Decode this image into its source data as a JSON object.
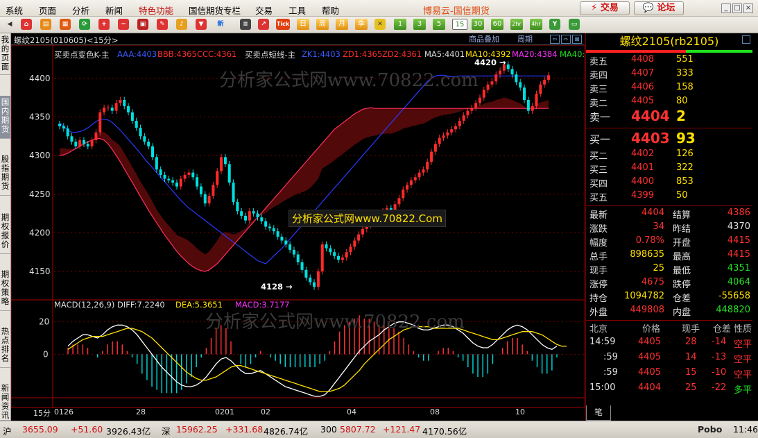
{
  "menu": {
    "items": [
      "系统",
      "页面",
      "分析",
      "新闻",
      "特色功能",
      "国信期货专栏",
      "交易",
      "工具",
      "帮助"
    ],
    "brand": "博易云-国信期货",
    "trade_btn": "交易",
    "forum_btn": "论坛"
  },
  "toolbar": {
    "labels": [
      "Tick",
      "日",
      "周",
      "月",
      "季",
      "1",
      "3",
      "5",
      "15",
      "30",
      "60",
      "2hr",
      "4hr"
    ]
  },
  "leftnav": [
    "我的页面",
    "国内期货",
    "股指期货",
    "期权报价",
    "期权策略",
    "热点排名",
    "新闻资讯"
  ],
  "chart_header": {
    "title": "螺纹2105(010605)<15分>",
    "overlay": "商品叠加",
    "period": "周期"
  },
  "main_legend": {
    "part1": "买卖点变色K-主",
    "aaa": "AAA:4403",
    "bbb": "BBB:4365",
    "ccc": "CCC:4361",
    "part2": "买卖点短线-主",
    "zk": "ZK1:4403",
    "zd1": "ZD1:4365",
    "zd2": "ZD2:4361",
    "ma5": "MA5:4401",
    "ma10": "MA10:4392",
    "ma20": "MA20:4384",
    "ma40": "MA40:4"
  },
  "macd_legend": {
    "name": "MACD(12,26,9)",
    "diff": "DIFF:7.2240",
    "dea": "DEA:5.3651",
    "macd": "MACD:3.7177"
  },
  "watermark": "分析家公式网www.70822.com",
  "watermark_box": "分析家公式网www.70822.Com",
  "annotations": {
    "high": "4420",
    "low": "4128"
  },
  "chart_data": {
    "type": "line",
    "ylim": [
      4115,
      4425
    ],
    "yticks": [
      4150,
      4200,
      4250,
      4300,
      4350,
      4400
    ],
    "macd_ylim": [
      -32,
      28
    ],
    "macd_yticks": [
      20,
      0
    ],
    "xlabels": [
      "0126",
      "28",
      "0201",
      "02",
      "04",
      "08",
      "10"
    ],
    "period_label": "15分",
    "close": [
      4338,
      4335,
      4325,
      4318,
      4312,
      4320,
      4315,
      4312,
      4320,
      4330,
      4356,
      4362,
      4362,
      4358,
      4368,
      4372,
      4364,
      4356,
      4345,
      4336,
      4325,
      4318,
      4312,
      4298,
      4282,
      4275,
      4270,
      4268,
      4265,
      4260,
      4270,
      4275,
      4278,
      4272,
      4260,
      4250,
      4238,
      4248,
      4262,
      4280,
      4298,
      4289,
      4265,
      4240,
      4228,
      4222,
      4216,
      4228,
      4225,
      4220,
      4215,
      4208,
      4206,
      4202,
      4195,
      4190,
      4185,
      4178,
      4172,
      4162,
      4152,
      4142,
      4136,
      4130,
      4150,
      4185,
      4180,
      4175,
      4170,
      4165,
      4168,
      4175,
      4182,
      4190,
      4198,
      4205,
      4210,
      4214,
      4220,
      4226,
      4228,
      4232,
      4230,
      4237,
      4245,
      4256,
      4262,
      4268,
      4272,
      4278,
      4282,
      4292,
      4305,
      4315,
      4323,
      4326,
      4330,
      4334,
      4338,
      4345,
      4352,
      4358,
      4362,
      4368,
      4375,
      4385,
      4392,
      4396,
      4405,
      4410,
      4418,
      4412,
      4405,
      4395,
      4388,
      4372,
      4358,
      4364,
      4380,
      4392,
      4398,
      4404
    ],
    "aaa": [
      4342,
      4338,
      4333,
      4330,
      4330,
      4331,
      4333,
      4336,
      4340,
      4344,
      4347,
      4347,
      4346,
      4343,
      4338,
      4333,
      4327,
      4321,
      4315,
      4309,
      4303,
      4296,
      4290,
      4284,
      4278,
      4272,
      4266,
      4260,
      4254,
      4248,
      4242,
      4237,
      4232,
      4228,
      4224,
      4220,
      4216,
      4212,
      4208,
      4204,
      4200,
      4196,
      4192,
      4188,
      4184,
      4180,
      4176,
      4172,
      4168,
      4164,
      4162,
      4160,
      4165,
      4170,
      4175,
      4180,
      4186,
      4192,
      4198,
      4204,
      4210,
      4216,
      4222,
      4228,
      4234,
      4240,
      4246,
      4252,
      4258,
      4264,
      4270,
      4276,
      4282,
      4288,
      4294,
      4300,
      4306,
      4312,
      4318,
      4324,
      4330,
      4336,
      4342,
      4348,
      4354,
      4360,
      4366,
      4372,
      4378,
      4384,
      4390,
      4396,
      4400,
      4403,
      4404,
      4404,
      4403,
      4402,
      4402,
      4403,
      4403,
      4403,
      4403,
      4403,
      4403,
      4403,
      4403,
      4403,
      4403,
      4403,
      4403,
      4403,
      4403,
      4403,
      4403,
      4403,
      4403,
      4403,
      4403,
      4403,
      4403,
      4403
    ],
    "ccc": [
      4300,
      4301,
      4303,
      4306,
      4309,
      4312,
      4315,
      4318,
      4320,
      4322,
      4322,
      4320,
      4315,
      4308,
      4300,
      4292,
      4283,
      4274,
      4265,
      4256,
      4247,
      4238,
      4229,
      4221,
      4213,
      4205,
      4197,
      4190,
      4183,
      4176,
      4170,
      4165,
      4160,
      4156,
      4153,
      4151,
      4150,
      4152,
      4156,
      4160,
      4166,
      4172,
      4178,
      4184,
      4190,
      4196,
      4202,
      4208,
      4214,
      4220,
      4226,
      4232,
      4238,
      4244,
      4250,
      4256,
      4262,
      4268,
      4274,
      4280,
      4286,
      4292,
      4298,
      4304,
      4310,
      4316,
      4322,
      4328,
      4334,
      4338,
      4342,
      4346,
      4350,
      4354,
      4357,
      4360,
      4361,
      4362,
      4361,
      4361,
      4361,
      4361,
      4361,
      4361,
      4361,
      4361,
      4361,
      4361,
      4361,
      4361,
      4361,
      4361,
      4361,
      4361,
      4361,
      4361,
      4361,
      4361,
      4361,
      4361,
      4361,
      4361,
      4361,
      4361,
      4361,
      4361,
      4361,
      4361,
      4361,
      4361,
      4361,
      4361,
      4361,
      4361,
      4361,
      4361,
      4361,
      4361,
      4361,
      4361,
      4361,
      4361
    ],
    "macd_diff": [
      5,
      8,
      10,
      12,
      12,
      11,
      10,
      12,
      15,
      17,
      18,
      18,
      17,
      15,
      12,
      8,
      4,
      0,
      -4,
      -8,
      -11,
      -14,
      -17,
      -19,
      -20,
      -20,
      -19,
      -17,
      -14,
      -10,
      -6,
      -3,
      -2,
      -4,
      -7,
      -10,
      -12,
      -12,
      -11,
      -10,
      -12,
      -14,
      -16,
      -18,
      -20,
      -21,
      -22,
      -23,
      -24,
      -25,
      -26,
      -26,
      -25,
      -22,
      -18,
      -14,
      -10,
      -6,
      -2,
      2,
      5,
      8,
      10,
      12,
      15,
      17,
      19,
      20,
      20,
      19,
      18,
      16,
      15,
      15,
      16,
      17,
      18,
      18,
      17,
      15,
      13,
      10,
      7,
      5,
      4,
      4,
      6,
      9,
      12,
      15,
      17,
      18,
      17,
      15,
      12,
      9,
      6,
      4,
      3,
      5
    ],
    "macd_dea": [
      3,
      5,
      7,
      9,
      10,
      11,
      11,
      11,
      12,
      13,
      14,
      15,
      16,
      16,
      15,
      14,
      12,
      10,
      7,
      4,
      1,
      -2,
      -5,
      -8,
      -11,
      -13,
      -15,
      -16,
      -16,
      -15,
      -14,
      -12,
      -10,
      -8,
      -7,
      -7,
      -8,
      -9,
      -10,
      -11,
      -12,
      -13,
      -14,
      -15,
      -16,
      -17,
      -18,
      -19,
      -20,
      -21,
      -22,
      -23,
      -23,
      -23,
      -22,
      -21,
      -19,
      -16,
      -13,
      -10,
      -6,
      -3,
      0,
      3,
      6,
      9,
      11,
      13,
      15,
      16,
      17,
      17,
      17,
      17,
      16,
      16,
      16,
      16,
      16,
      16,
      15,
      14,
      13,
      12,
      11,
      10,
      9,
      9,
      10,
      11,
      12,
      13,
      14,
      14,
      14,
      13,
      12,
      10,
      8,
      6,
      5,
      5
    ]
  },
  "quote": {
    "title": "螺纹2105(rb2105)",
    "asks": [
      [
        "卖五",
        "4408",
        "551"
      ],
      [
        "卖四",
        "4407",
        "333"
      ],
      [
        "卖三",
        "4406",
        "158"
      ],
      [
        "卖二",
        "4405",
        "80"
      ],
      [
        "卖一",
        "4404",
        "2"
      ]
    ],
    "bids": [
      [
        "买一",
        "4403",
        "93"
      ],
      [
        "买二",
        "4402",
        "126"
      ],
      [
        "买三",
        "4401",
        "322"
      ],
      [
        "买四",
        "4400",
        "853"
      ],
      [
        "买五",
        "4399",
        "50"
      ]
    ],
    "stats": [
      [
        "最新",
        "4404",
        "结算",
        "4386"
      ],
      [
        "涨跌",
        "34",
        "昨结",
        "4370"
      ],
      [
        "幅度",
        "0.78%",
        "开盘",
        "4415"
      ],
      [
        "总手",
        "898635",
        "最高",
        "4415"
      ],
      [
        "现手",
        "25",
        "最低",
        "4351"
      ],
      [
        "涨停",
        "4675",
        "跌停",
        "4064"
      ],
      [
        "持仓",
        "1094782",
        "仓差",
        "-55658"
      ],
      [
        "外盘",
        "449808",
        "内盘",
        "448820"
      ]
    ],
    "tick_header": [
      "北京",
      "价格",
      "现手",
      "仓差",
      "性质"
    ],
    "ticks": [
      [
        "14:59",
        "4405",
        "28",
        "-14",
        "空平"
      ],
      [
        ":59",
        "4405",
        "14",
        "-13",
        "空平"
      ],
      [
        ":59",
        "4405",
        "15",
        "-10",
        "空平"
      ],
      [
        "15:00",
        "4404",
        "25",
        "-22",
        "多平"
      ]
    ],
    "tab": "笔"
  },
  "status": {
    "sh_label": "沪",
    "sh": "3655.09",
    "sh_chg": "+51.60",
    "sh_amt": "3926.43亿",
    "sz_label": "深",
    "sz": "15962.25",
    "sz_chg": "+331.68",
    "sz_amt": "4826.74亿",
    "c300_label": "300",
    "c300": "5807.72",
    "c300_chg": "+121.47",
    "c300_amt": "4170.56亿",
    "logo": "Pobo",
    "time": "11:46"
  }
}
